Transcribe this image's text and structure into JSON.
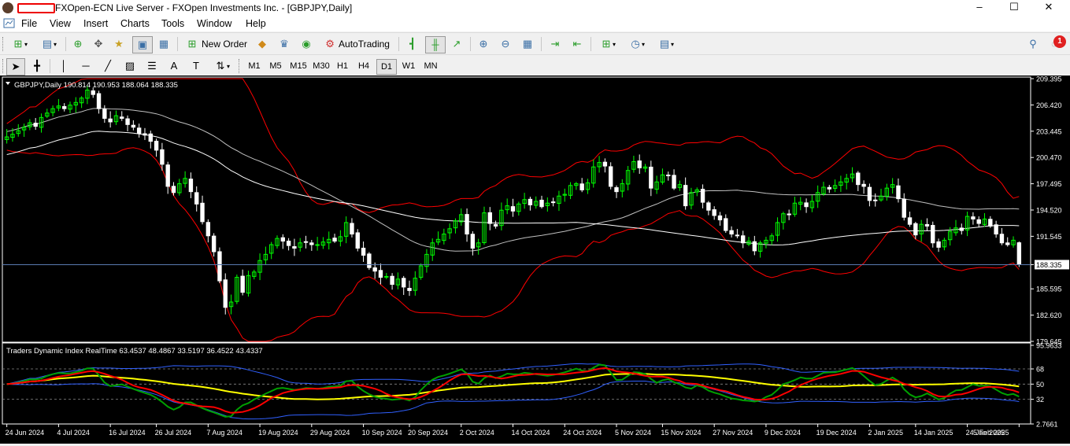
{
  "window": {
    "title": "FXOpen-ECN Live Server - FXOpen Investments Inc. - [GBPJPY,Daily]",
    "controls": [
      "–",
      "☐",
      "✕"
    ],
    "mdi_controls": [
      "–",
      "⧉",
      "✕"
    ]
  },
  "menu": [
    "File",
    "View",
    "Insert",
    "Charts",
    "Tools",
    "Window",
    "Help"
  ],
  "toolbar": {
    "new_order": "New Order",
    "autotrading": "AutoTrading",
    "notification_count": "1"
  },
  "timeframes": [
    "M1",
    "M5",
    "M15",
    "M30",
    "H1",
    "H4",
    "D1",
    "W1",
    "MN"
  ],
  "active_timeframe": "D1",
  "icons": {
    "drawing": [
      "cursor-icon",
      "crosshair-icon",
      "vertical-line-icon",
      "horizontal-line-icon",
      "trendline-icon",
      "channel-icon",
      "fibonacci-icon",
      "text-icon",
      "text-label-icon",
      "arrows-icon"
    ]
  },
  "colors": {
    "background": "#000000",
    "bull_candle": "#00ff00",
    "bear_candle": "#ffffff",
    "bollinger": "#ff0000",
    "ma_fast": "#c0c0c0",
    "ma_slow": "#ffffff",
    "tdi_price": "#00a000",
    "tdi_signal": "#ff0000",
    "tdi_market_base": "#ffff00",
    "tdi_bands": "#3060ff",
    "price_line": "#5a7ab0"
  },
  "chart_data": [
    {
      "type": "candlestick",
      "title": "GBPJPY,Daily  190.814 190.953 188.064 188.335",
      "symbol": "GBPJPY,Daily",
      "ohlc_last": [
        190.814,
        190.953,
        188.064,
        188.335
      ],
      "ylim": [
        179.645,
        209.395
      ],
      "yticks": [
        "209.395",
        "206.420",
        "203.445",
        "200.470",
        "197.495",
        "194.520",
        "191.545",
        "188.335",
        "185.595",
        "182.620",
        "179.645"
      ],
      "current_price": "188.335",
      "xticks": [
        "24 Jun 2024",
        "4 Jul 2024",
        "16 Jul 2024",
        "26 Jul 2024",
        "7 Aug 2024",
        "19 Aug 2024",
        "29 Aug 2024",
        "10 Sep 2024",
        "20 Sep 2024",
        "2 Oct 2024",
        "14 Oct 2024",
        "24 Oct 2024",
        "5 Nov 2024",
        "15 Nov 2024",
        "27 Nov 2024",
        "9 Dec 2024",
        "19 Dec 2024",
        "2 Jan 2025",
        "14 Jan 2025",
        "24 Jan 2025",
        "5 Feb 2025"
      ],
      "close": [
        202.8,
        203.1,
        203.5,
        203.9,
        204.4,
        204.0,
        205.0,
        205.5,
        206.0,
        206.3,
        206.0,
        206.4,
        206.7,
        207.2,
        208.1,
        207.6,
        206.0,
        204.9,
        204.5,
        205.2,
        204.9,
        204.2,
        203.9,
        203.2,
        203.0,
        202.3,
        201.3,
        199.7,
        197.2,
        196.5,
        197.5,
        198.1,
        196.6,
        195.2,
        193.2,
        191.6,
        189.8,
        186.5,
        183.5,
        184.1,
        186.9,
        185.2,
        187.1,
        187.5,
        188.8,
        189.5,
        190.6,
        191.3,
        191.0,
        190.5,
        190.2,
        190.8,
        190.9,
        190.6,
        190.6,
        190.9,
        191.2,
        191.0,
        191.5,
        193.1,
        191.8,
        190.2,
        189.4,
        188.0,
        187.6,
        186.9,
        187.0,
        186.1,
        186.7,
        185.8,
        185.4,
        186.8,
        188.2,
        189.5,
        190.8,
        191.2,
        191.8,
        192.4,
        193.3,
        194.0,
        191.8,
        190.2,
        190.8,
        194.2,
        193.0,
        192.7,
        194.5,
        195.0,
        194.4,
        195.2,
        195.7,
        195.1,
        195.5,
        194.9,
        195.3,
        195.4,
        196.1,
        196.3,
        197.3,
        197.5,
        196.8,
        197.6,
        199.4,
        199.9,
        199.5,
        197.2,
        196.6,
        197.5,
        199.0,
        200.0,
        199.3,
        199.4,
        197.0,
        197.7,
        198.5,
        198.4,
        197.0,
        197.4,
        195.0,
        196.5,
        196.8,
        195.4,
        194.5,
        193.9,
        193.4,
        192.2,
        191.8,
        191.6,
        190.8,
        191.0,
        189.9,
        190.8,
        191.1,
        191.6,
        193.1,
        194.1,
        194.0,
        195.3,
        195.4,
        194.9,
        195.5,
        196.5,
        197.1,
        196.9,
        197.3,
        197.7,
        198.1,
        198.6,
        197.4,
        197.2,
        195.6,
        195.6,
        196.1,
        197.0,
        197.4,
        195.8,
        193.7,
        192.9,
        191.7,
        192.9,
        192.7,
        190.8,
        190.3,
        191.1,
        192.1,
        192.5,
        192.2,
        193.8,
        193.5,
        193.0,
        193.5,
        192.7,
        191.8,
        190.8,
        190.6,
        191.1,
        188.3
      ],
      "indicators": [
        "Bollinger Bands",
        "Moving Average (fast)",
        "Moving Average (slow)"
      ]
    },
    {
      "type": "line",
      "title": "Traders Dynamic Index RealTime 63.4537 48.4867 33.5197 36.4522 43.4337",
      "values_last": [
        63.4537,
        48.4867,
        33.5197,
        36.4522,
        43.4337
      ],
      "ylim": [
        2.7661,
        95.9633
      ],
      "yticks": [
        "95.9633",
        "68",
        "50",
        "32",
        "2.7661"
      ],
      "levels": [
        68,
        50,
        32
      ],
      "series": []
    }
  ]
}
